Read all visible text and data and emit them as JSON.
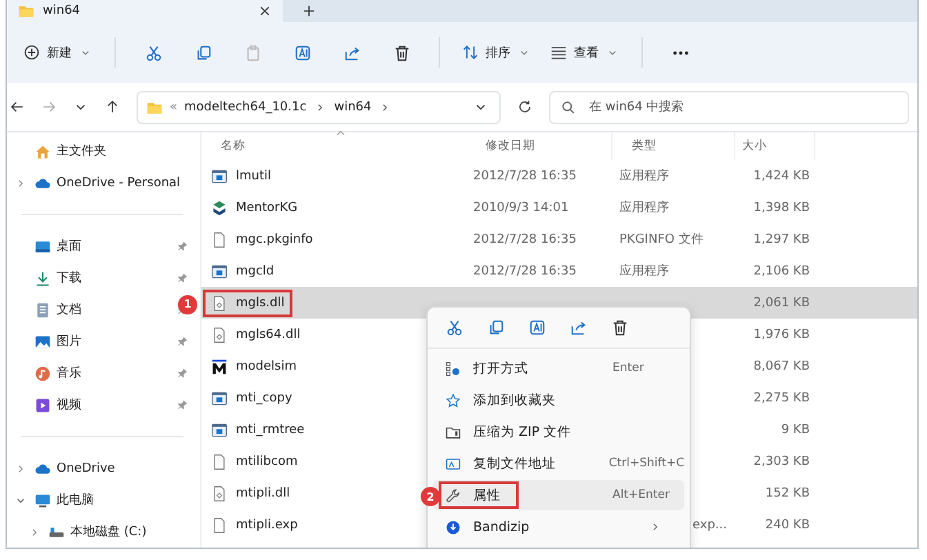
{
  "tabs": [
    {
      "label": "win64",
      "selected": true
    }
  ],
  "toolbar": {
    "new": {
      "label": "新建"
    },
    "actions": [
      {
        "disabled": false
      },
      {
        "disabled": false
      },
      {
        "disabled": true
      },
      {
        "disabled": false
      },
      {
        "disabled": false
      },
      {
        "disabled": false
      }
    ],
    "sort": {
      "label": "排序"
    },
    "view": {
      "label": "查看"
    }
  },
  "address": {
    "overflow": "«",
    "crumbs": [
      "modeltech64_10.1c",
      "win64"
    ],
    "search": {
      "placeholder": "在 win64 中搜索"
    }
  },
  "sidebar": {
    "groups": [
      [
        {
          "label": "主文件夹",
          "pinned": false
        },
        {
          "label": "OneDrive - Personal",
          "expanded": false,
          "pinned": false
        }
      ],
      [
        {
          "label": "桌面",
          "pinned": true
        },
        {
          "label": "下载",
          "pinned": true
        },
        {
          "label": "文档",
          "pinned": true
        },
        {
          "label": "图片",
          "pinned": true
        },
        {
          "label": "音乐",
          "pinned": true
        },
        {
          "label": "视频",
          "pinned": true
        }
      ],
      [
        {
          "label": "OneDrive",
          "expanded": false,
          "pinned": false
        },
        {
          "label": "此电脑",
          "expanded": true,
          "pinned": false,
          "children": [
            {
              "label": "本地磁盘 (C:)",
              "expanded": false,
              "pinned": false
            }
          ]
        }
      ]
    ]
  },
  "table": {
    "columns": [
      {
        "label": "名称",
        "sorted": true
      },
      {
        "label": "修改日期",
        "sorted": false
      },
      {
        "label": "类型",
        "sorted": false
      },
      {
        "label": "大小",
        "sorted": false
      }
    ],
    "rows": [
      {
        "kind": "app",
        "name": "lmutil",
        "date": "2012/7/28 16:35",
        "type": "应用程序",
        "size": "1,424 KB",
        "selected": false
      },
      {
        "kind": "kg",
        "name": "MentorKG",
        "date": "2010/9/3 14:01",
        "type": "应用程序",
        "size": "1,398 KB",
        "selected": false
      },
      {
        "kind": "file",
        "name": "mgc.pkginfo",
        "date": "2012/7/28 16:35",
        "type": "PKGINFO 文件",
        "size": "1,297 KB",
        "selected": false
      },
      {
        "kind": "app",
        "name": "mgcld",
        "date": "2012/7/28 16:35",
        "type": "应用程序",
        "size": "2,106 KB",
        "selected": false
      },
      {
        "kind": "dll",
        "name": "mgls.dll",
        "size": "2,061 KB",
        "selected": true,
        "callout": "1"
      },
      {
        "kind": "dll",
        "name": "mgls64.dll",
        "size": "1,976 KB",
        "selected": false
      },
      {
        "kind": "sim",
        "name": "modelsim",
        "size": "8,067 KB",
        "selected": false
      },
      {
        "kind": "app",
        "name": "mti_copy",
        "size": "2,275 KB",
        "selected": false
      },
      {
        "kind": "app",
        "name": "mti_rmtree",
        "size": "9 KB",
        "selected": false
      },
      {
        "kind": "file",
        "name": "mtilibcom",
        "size": "2,303 KB",
        "selected": false
      },
      {
        "kind": "dll",
        "name": "mtipli.dll",
        "size": "152 KB",
        "selected": false
      },
      {
        "kind": "file",
        "name": "mtipli.exp",
        "type": "exp...",
        "size": "240 KB",
        "selected": false
      }
    ]
  },
  "context_menu": {
    "items": [
      {
        "label": "打开方式",
        "shortcut": "Enter",
        "selected": false,
        "submenu": false
      },
      {
        "label": "添加到收藏夹",
        "selected": false,
        "submenu": false
      },
      {
        "label": "压缩为 ZIP 文件",
        "selected": false,
        "submenu": false
      },
      {
        "label": "复制文件地址",
        "shortcut": "Ctrl+Shift+C",
        "selected": false,
        "submenu": false
      },
      {
        "label": "属性",
        "shortcut": "Alt+Enter",
        "selected": true,
        "submenu": false,
        "callout": "2"
      },
      {
        "label": "Bandizip",
        "selected": false,
        "submenu": true
      }
    ]
  }
}
